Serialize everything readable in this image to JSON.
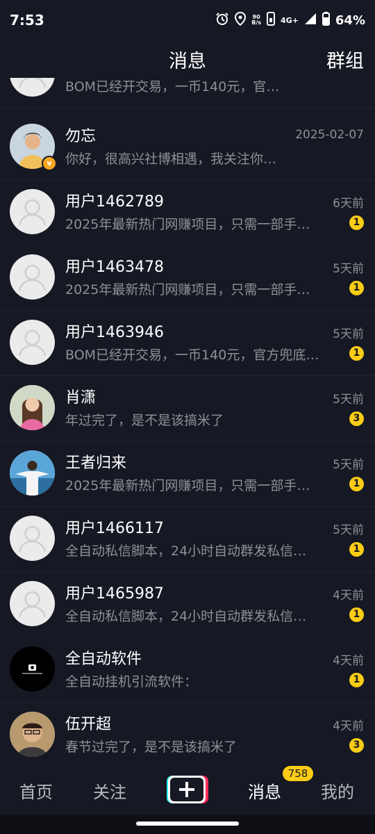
{
  "status_bar": {
    "time": "7:53",
    "net_speed_value": "90",
    "net_speed_unit": "B/s",
    "network": "4G+",
    "battery": "64%"
  },
  "header": {
    "title": "消息",
    "group_label": "群组"
  },
  "conversations": [
    {
      "name": "",
      "preview": "BOM已经开交易，一币140元，官…",
      "time": "",
      "badge": ""
    },
    {
      "name": "勿忘",
      "preview": "你好，很高兴社博相遇，我关注你…",
      "time": "2025-02-07",
      "badge": ""
    },
    {
      "name": "用户1462789",
      "preview": "2025年最新热门网赚项目，只需一部手…",
      "time": "6天前",
      "badge": "1"
    },
    {
      "name": "用户1463478",
      "preview": "2025年最新热门网赚项目，只需一部手…",
      "time": "5天前",
      "badge": "1"
    },
    {
      "name": "用户1463946",
      "preview": "BOM已经开交易，一币140元，官方兜底…",
      "time": "5天前",
      "badge": "1"
    },
    {
      "name": "肖潇",
      "preview": "年过完了，是不是该搞米了",
      "time": "5天前",
      "badge": "3"
    },
    {
      "name": "王者归来",
      "preview": "2025年最新热门网赚项目，只需一部手…",
      "time": "5天前",
      "badge": "1"
    },
    {
      "name": "用户1466117",
      "preview": "全自动私信脚本，24小时自动群发私信…",
      "time": "5天前",
      "badge": "1"
    },
    {
      "name": "用户1465987",
      "preview": "全自动私信脚本，24小时自动群发私信…",
      "time": "4天前",
      "badge": "1"
    },
    {
      "name": "全自动软件",
      "preview": "全自动挂机引流软件：",
      "time": "4天前",
      "badge": "1"
    },
    {
      "name": "伍开超",
      "preview": "春节过完了，是不是该搞米了",
      "time": "4天前",
      "badge": "3"
    }
  ],
  "bottom_nav": {
    "home": "首页",
    "follow": "关注",
    "messages": "消息",
    "me": "我的",
    "messages_badge": "758"
  },
  "colors": {
    "background": "#161823",
    "badge": "#facc15",
    "secondary_text": "#8f9096",
    "plus_left": "#25f4ee",
    "plus_right": "#fe2c55"
  }
}
